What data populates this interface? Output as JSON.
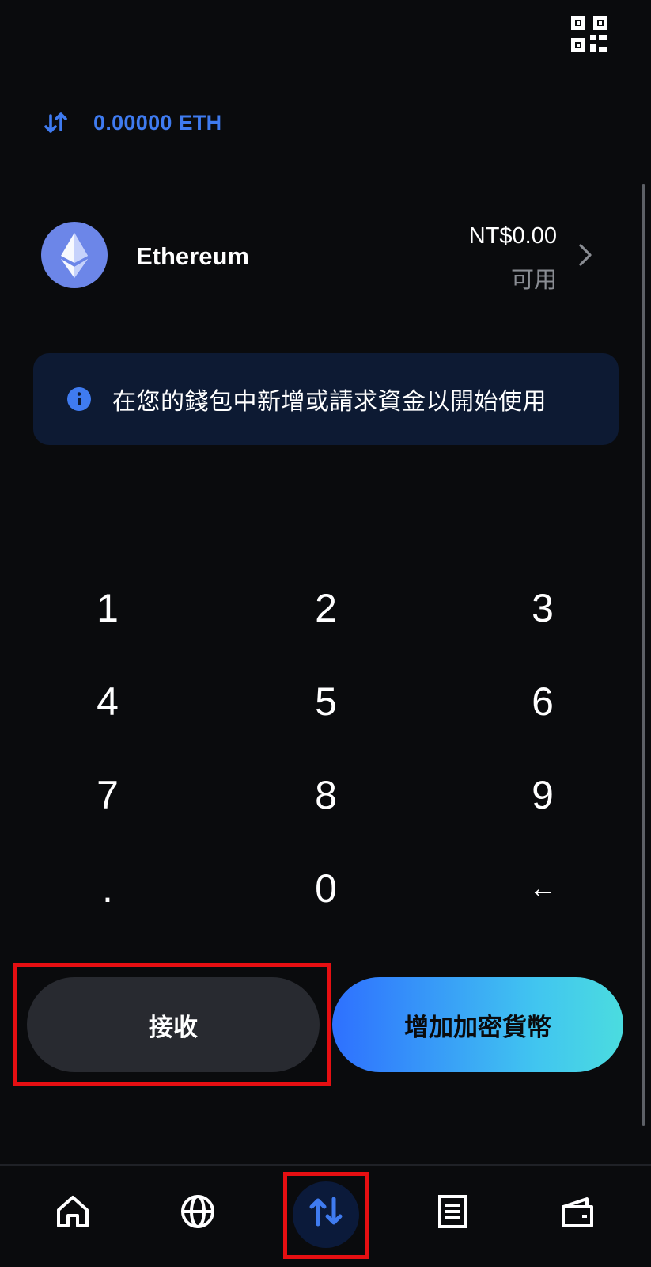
{
  "header": {
    "qr_icon": "qr-code-icon",
    "swap_icon": "swap-arrows-icon",
    "amount": "0.00000 ETH"
  },
  "asset": {
    "name": "Ethereum",
    "logo_icon": "ethereum-logo",
    "value": "NT$0.00",
    "status": "可用",
    "chevron_icon": "chevron-right-icon"
  },
  "info": {
    "icon": "info-icon",
    "message": "在您的錢包中新增或請求資金以開始使用"
  },
  "keypad": {
    "keys": [
      "1",
      "2",
      "3",
      "4",
      "5",
      "6",
      "7",
      "8",
      "9",
      ".",
      "0",
      "←"
    ]
  },
  "actions": {
    "receive_label": "接收",
    "add_crypto_label": "增加加密貨幣"
  },
  "nav": {
    "items": [
      "home-icon",
      "globe-icon",
      "swap-icon",
      "list-icon",
      "wallet-icon"
    ],
    "active": "swap-icon"
  },
  "colors": {
    "accent": "#3f7bf0",
    "background": "#0a0b0d",
    "highlight": "#e60f12",
    "gradient_start": "#2e70ff",
    "gradient_end": "#4bdcdf"
  }
}
